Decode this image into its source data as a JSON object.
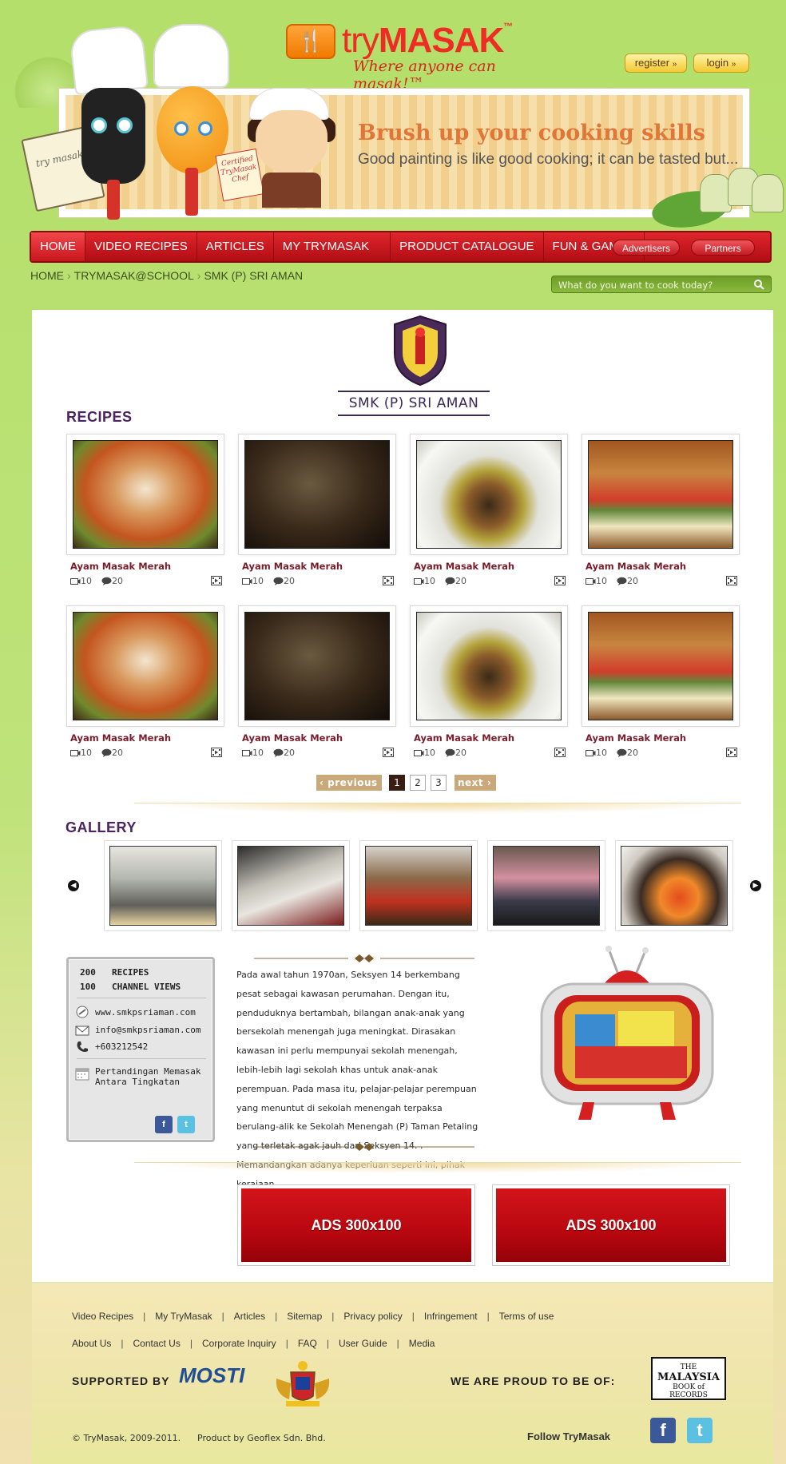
{
  "brand": {
    "logo_try": "try",
    "logo_masak": "MASAK",
    "logo_tm": "™",
    "tagline": "Where anyone can masak!™"
  },
  "header": {
    "register_label": "register",
    "login_label": "login",
    "banner_title": "Brush up your cooking skills",
    "banner_subtitle": "Good painting is like good cooking; it can be tasted but...",
    "book_text": "try masak",
    "chef_card_text": "Certified TryMasak Chef"
  },
  "nav": {
    "items": [
      {
        "label": "HOME"
      },
      {
        "label": "VIDEO RECIPES"
      },
      {
        "label": "ARTICLES"
      },
      {
        "label": "MY TRYMASAK"
      },
      {
        "label": "PRODUCT CATALOGUE"
      },
      {
        "label": "FUN & GAMES"
      }
    ],
    "advertisers": "Advertisers",
    "partners": "Partners"
  },
  "breadcrumb": [
    "HOME",
    "TRYMASAK@SCHOOL",
    "SMK (P) SRI AMAN"
  ],
  "search": {
    "placeholder": "What do you want to cook today?"
  },
  "school": {
    "name": "SMK (P) SRI AMAN"
  },
  "recipes": {
    "heading": "RECIPES",
    "items": [
      {
        "name": "Ayam Masak Merah",
        "videos": "10",
        "comments": "20"
      },
      {
        "name": "Ayam Masak Merah",
        "videos": "10",
        "comments": "20"
      },
      {
        "name": "Ayam Masak Merah",
        "videos": "10",
        "comments": "20"
      },
      {
        "name": "Ayam Masak Merah",
        "videos": "10",
        "comments": "20"
      },
      {
        "name": "Ayam Masak Merah",
        "videos": "10",
        "comments": "20"
      },
      {
        "name": "Ayam Masak Merah",
        "videos": "10",
        "comments": "20"
      },
      {
        "name": "Ayam Masak Merah",
        "videos": "10",
        "comments": "20"
      },
      {
        "name": "Ayam Masak Merah",
        "videos": "10",
        "comments": "20"
      }
    ]
  },
  "pager": {
    "previous": "previous",
    "next": "next",
    "pages": [
      "1",
      "2",
      "3"
    ],
    "current": "1"
  },
  "gallery": {
    "heading": "GALLERY"
  },
  "info": {
    "recipes_count": "200",
    "recipes_label": "RECIPES",
    "views_count": "100",
    "views_label": "CHANNEL VIEWS",
    "website": "www.smkpsriaman.com",
    "email": "info@smkpsriaman.com",
    "phone": "+603212542",
    "event_line1": "Pertandingan Memasak",
    "event_line2": "Antara Tingkatan"
  },
  "story": {
    "text": "Pada awal tahun 1970an, Seksyen 14 berkembang pesat sebagai kawasan perumahan. Dengan itu, penduduknya bertambah, bilangan anak-anak yang bersekolah menengah juga meningkat. Dirasakan kawasan ini perlu mempunyai sekolah menengah, lebih-lebih lagi sekolah khas untuk anak-anak perempuan. Pada masa itu, pelajar-pelajar perempuan yang menuntut di sekolah menengah terpaksa berulang-alik ke Sekolah Menengah (P) Taman Petaling yang terletak agak jauh dari Seksyen 14. . Memandangkan adanya keperluan seperti ini, pihak kerajaan"
  },
  "ads": [
    "ADS 300x100",
    "ADS 300x100"
  ],
  "footer": {
    "links_row1": [
      "Video Recipes",
      "My TryMasak",
      "Articles",
      "Sitemap",
      "Privacy policy",
      "Infringement",
      "Terms of use"
    ],
    "links_row2": [
      "About Us",
      "Contact Us",
      "Corporate Inquiry",
      "FAQ",
      "User Guide",
      "Media"
    ],
    "supported_by": "SUPPORTED BY",
    "mosti": "MOSTI",
    "proud": "WE ARE PROUD TO BE OF:",
    "mbr_the": "THE",
    "mbr_malaysia": "MALAYSIA",
    "mbr_book": "BOOK of RECORDS",
    "copyright": "© TryMasak, 2009-2011.",
    "product_by": "Product by Geoflex Sdn. Bhd.",
    "follow": "Follow TryMasak"
  },
  "colors": {
    "nav_red": "#c8161c",
    "recipe_name": "#7a1d2a",
    "heading_purple": "#4b2360",
    "background_green": "#b3df6a"
  }
}
